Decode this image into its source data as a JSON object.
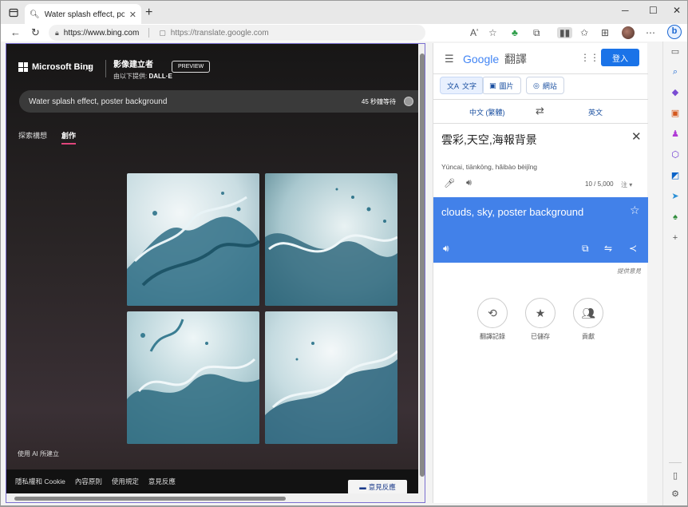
{
  "browser": {
    "tab_title": "Water splash effect, poster background",
    "new_tab_symbol": "+",
    "url_primary": "https://www.bing.com",
    "url_secondary": "https://translate.google.com"
  },
  "bing": {
    "logo_text": "Microsoft Bing",
    "creator_title": "影像建立者",
    "creator_by_prefix": "由以下提供: ",
    "creator_by_brand": "DALL·E",
    "preview_label": "PREVIEW",
    "prompt_text": "Water splash effect, poster background",
    "boost_text": "45 秒鐘等待",
    "tabs": [
      {
        "label": "探索構想"
      },
      {
        "label": "創作"
      }
    ],
    "ai_note": "使用 AI 所建立",
    "footer_links": [
      {
        "label": "隱私權和 Cookie"
      },
      {
        "label": "內容原則"
      },
      {
        "label": "使用規定"
      },
      {
        "label": "意見反應"
      }
    ],
    "feedback_button": "意見反應"
  },
  "translate": {
    "logo_google": "Google",
    "logo_product": "翻譯",
    "signin_label": "登入",
    "modes": [
      {
        "label": "文字"
      },
      {
        "label": "圖片"
      },
      {
        "label": "網站"
      }
    ],
    "source_lang": "中文 (繁體)",
    "target_lang": "英文",
    "source_text": "雲彩,天空,海報背景",
    "romanization": "Yúncai, tiānkōng, hǎibào bèijǐng",
    "char_count": "10 / 5,000",
    "note_label": "注",
    "output_text": "clouds, sky, poster background",
    "feedback_link": "提供意見",
    "bottom_actions": [
      {
        "label": "翻譯記錄"
      },
      {
        "label": "已儲存"
      },
      {
        "label": "貢獻"
      }
    ]
  },
  "colors": {
    "bing_accent": "#e0457b",
    "translate_blue": "#4281e9",
    "signin_blue": "#1a73e8",
    "pane_border": "#7b6fd0"
  }
}
